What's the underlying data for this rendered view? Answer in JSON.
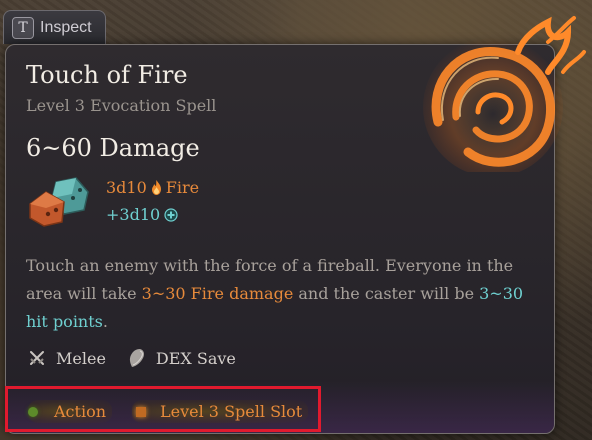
{
  "inspect": {
    "key": "T",
    "label": "Inspect"
  },
  "spell": {
    "name": "Touch of Fire",
    "subtitle": "Level 3 Evocation Spell",
    "damage_title": "6~60 Damage",
    "dice": {
      "primary": "3d10",
      "element": "Fire",
      "bonus": "+3d10"
    },
    "description": {
      "part1": "Touch an enemy with the force of a fireball. Everyone in the area will take ",
      "fire_damage": "3~30 Fire damage",
      "part2": " and the caster will be ",
      "hp_amount": "3~30",
      "hp_label": "hit points",
      "part3": "."
    },
    "traits": [
      {
        "label": "Melee",
        "icon": "crossed-swords-icon"
      },
      {
        "label": "DEX Save",
        "icon": "shield-icon"
      }
    ],
    "costs": [
      {
        "label": "Action",
        "icon": "green-dot-icon"
      },
      {
        "label": "Level 3 Spell Slot",
        "icon": "spell-slot-icon"
      }
    ]
  },
  "colors": {
    "accent_orange": "#e78a3b",
    "accent_cyan": "#6fd0d0",
    "highlight_red": "#e01a2e",
    "action_green": "#5d8b2a"
  }
}
